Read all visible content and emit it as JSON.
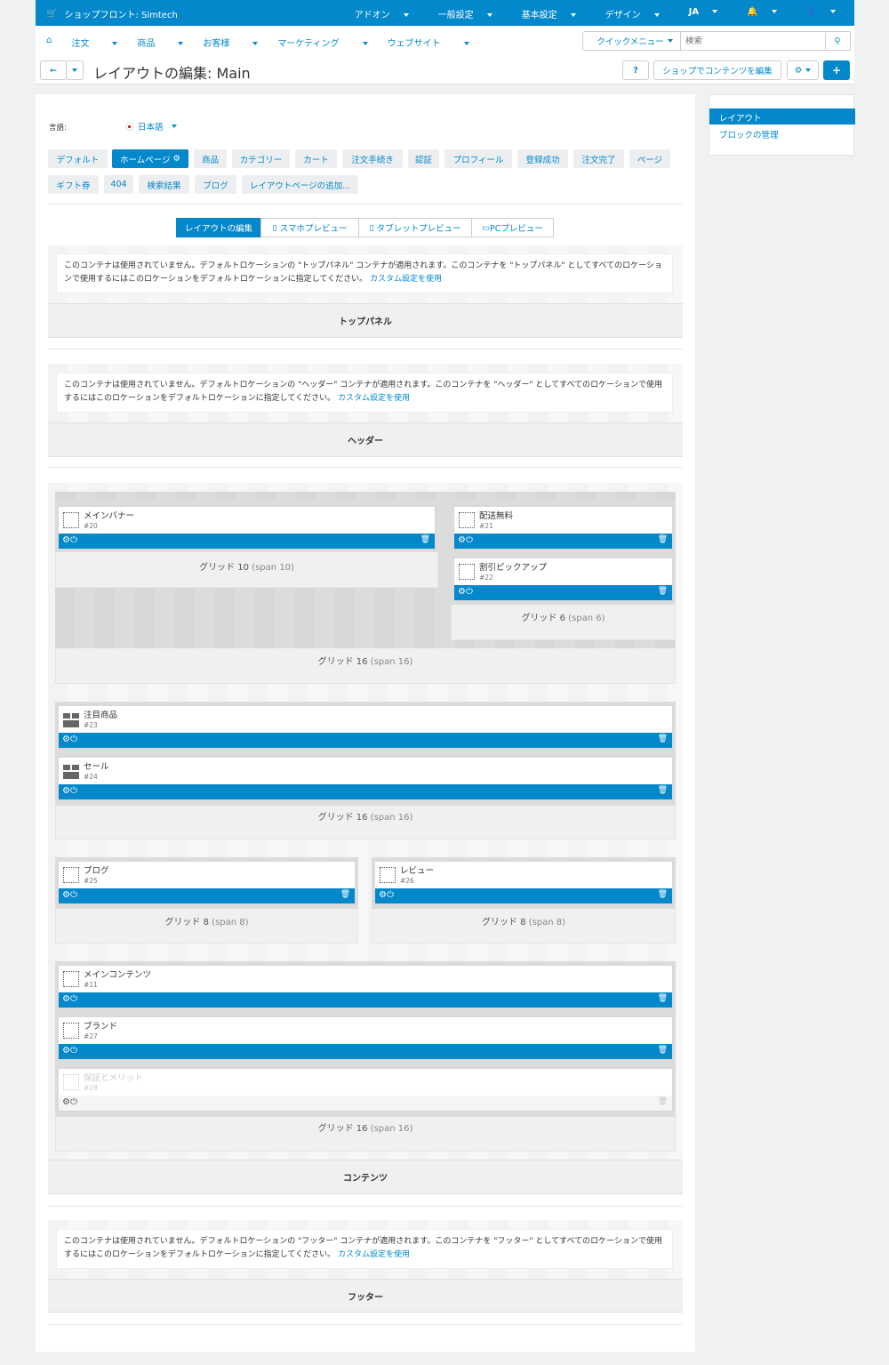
{
  "topbar": {
    "store": "ショップフロント: Simtech",
    "items": [
      "アドオン",
      "一般設定",
      "基本設定",
      "デザイン",
      "JA",
      "🔔",
      "👤"
    ]
  },
  "menu": {
    "home_icon": "home-icon",
    "items": [
      "注文",
      "商品",
      "お客様",
      "マーケティング",
      "ウェブサイト"
    ]
  },
  "quick_menu": "クイックメニュー",
  "search_placeholder": "検索",
  "page_title": "レイアウトの編集: Main",
  "help_label": "?",
  "edit_on_store": "ショップでコンテンツを編集",
  "add_label": "+",
  "sidebar": {
    "active": "レイアウト",
    "link": "ブロックの管理"
  },
  "language": {
    "label": "言語:",
    "value": "日本語"
  },
  "tabs": [
    "デフォルト",
    "ホームページ",
    "商品",
    "カテゴリー",
    "カート",
    "注文手続き",
    "認証",
    "プロフィール",
    "登録成功",
    "注文完了",
    "ページ",
    "ギフト券",
    "404",
    "検索結果",
    "ブログ",
    "レイアウトページの追加..."
  ],
  "preview_tabs": [
    "レイアウトの編集",
    "スマホプレビュー",
    "タブレットプレビュー",
    "PCプレビュー"
  ],
  "notices": {
    "top": {
      "pre": "このコンテナは使用されていません。デフォルトロケーションの \"トップパネル\" コンテナが適用されます。このコンテナを \"トップパネル\" としてすべてのロケーションで使用するにはこのロケーションをデフォルトロケーションに指定してください。",
      "link": "カスタム設定を使用"
    },
    "header": {
      "pre": "このコンテナは使用されていません。デフォルトロケーションの \"ヘッダー\" コンテナが適用されます。このコンテナを \"ヘッダー\" としてすべてのロケーションで使用するにはこのロケーションをデフォルトロケーションに指定してください。",
      "link": "カスタム設定を使用"
    },
    "footer": {
      "pre": "このコンテナは使用されていません。デフォルトロケーションの \"フッター\" コンテナが適用されます。このコンテナを \"フッター\" としてすべてのロケーションで使用するにはこのロケーションをデフォルトロケーションに指定してください。",
      "link": "カスタム設定を使用"
    }
  },
  "containers": {
    "top": "トップパネル",
    "header": "ヘッダー",
    "content": "コンテンツ",
    "footer": "フッター"
  },
  "grids": {
    "g10": {
      "name": "グリッド 10",
      "span": "(span 10)"
    },
    "g6": {
      "name": "グリッド 6",
      "span": "(span 6)"
    },
    "g16a": {
      "name": "グリッド 16",
      "span": "(span 16)"
    },
    "g16b": {
      "name": "グリッド 16",
      "span": "(span 16)"
    },
    "g8a": {
      "name": "グリッド 8",
      "span": "(span 8)"
    },
    "g8b": {
      "name": "グリッド 8",
      "span": "(span 8)"
    },
    "g16c": {
      "name": "グリッド 16",
      "span": "(span 16)"
    }
  },
  "blocks": {
    "b20": {
      "name": "メインバナー",
      "id": "#20"
    },
    "b21": {
      "name": "配送無料",
      "id": "#21"
    },
    "b22": {
      "name": "割引ピックアップ",
      "id": "#22"
    },
    "b23": {
      "name": "注目商品",
      "id": "#23"
    },
    "b24": {
      "name": "セール",
      "id": "#24"
    },
    "b25": {
      "name": "ブログ",
      "id": "#25"
    },
    "b26": {
      "name": "レビュー",
      "id": "#26"
    },
    "b11": {
      "name": "メインコンテンツ",
      "id": "#11"
    },
    "b27": {
      "name": "ブランド",
      "id": "#27"
    },
    "b28": {
      "name": "保証とメリット",
      "id": "#28"
    }
  },
  "block_controls": {
    "settings": "⚙",
    "power": "⏻",
    "delete": "🗑"
  },
  "colors": {
    "accent": "#0388cc"
  }
}
